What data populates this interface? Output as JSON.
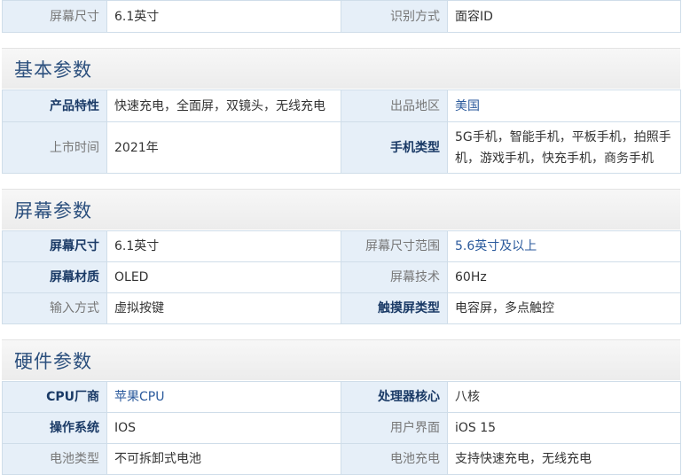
{
  "top_row": {
    "k1": "屏幕尺寸",
    "v1": "6.1英寸",
    "k2": "识别方式",
    "v2": "面容ID"
  },
  "basic": {
    "title": "基本参数",
    "rows": [
      {
        "k1": "产品特性",
        "v1": "快速充电，全面屏，双镜头，无线充电",
        "k2": "出品地区",
        "v2": "美国"
      },
      {
        "k1": "上市时间",
        "v1": "2021年",
        "k2": "手机类型",
        "v2": "5G手机，智能手机，平板手机，拍照手机，游戏手机，快充手机，商务手机"
      }
    ]
  },
  "screen": {
    "title": "屏幕参数",
    "rows": [
      {
        "k1": "屏幕尺寸",
        "v1": "6.1英寸",
        "k2": "屏幕尺寸范围",
        "v2": "5.6英寸及以上"
      },
      {
        "k1": "屏幕材质",
        "v1": "OLED",
        "k2": "屏幕技术",
        "v2": "60Hz"
      },
      {
        "k1": "输入方式",
        "v1": "虚拟按键",
        "k2": "触摸屏类型",
        "v2": "电容屏，多点触控"
      }
    ]
  },
  "hardware": {
    "title": "硬件参数",
    "rows": [
      {
        "k1": "CPU厂商",
        "v1": "苹果CPU",
        "k2": "处理器核心",
        "v2": "八核"
      },
      {
        "k1": "操作系统",
        "v1": "IOS",
        "k2": "用户界面",
        "v2": "iOS 15"
      },
      {
        "k1": "电池类型",
        "v1": "不可拆卸式电池",
        "k2": "电池充电",
        "v2": "支持快速充电，无线充电"
      }
    ]
  }
}
